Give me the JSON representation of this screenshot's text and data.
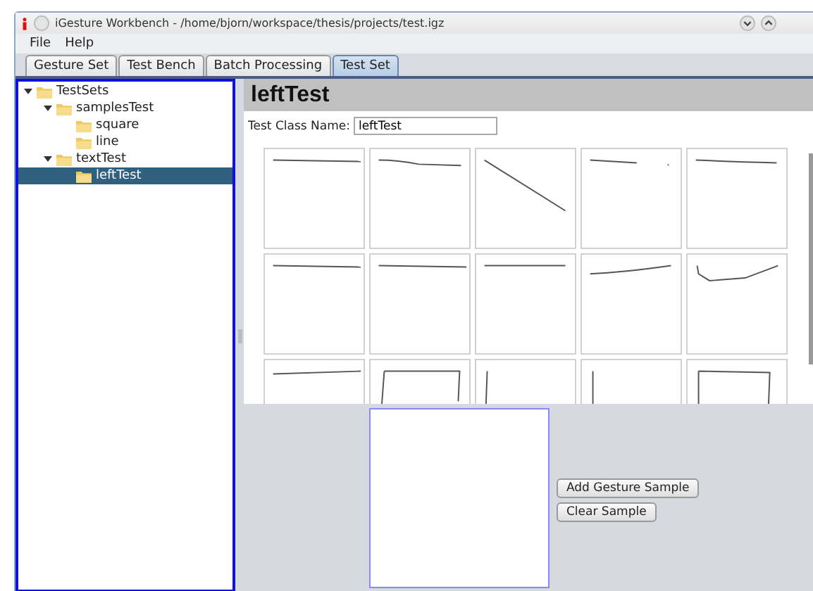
{
  "window": {
    "title": "iGesture Workbench - /home/bjorn/workspace/thesis/projects/test.igz"
  },
  "menu": [
    "File",
    "Help"
  ],
  "tabs": [
    {
      "label": "Gesture Set",
      "selected": false
    },
    {
      "label": "Test Bench",
      "selected": false
    },
    {
      "label": "Batch Processing",
      "selected": false
    },
    {
      "label": "Test Set",
      "selected": true
    }
  ],
  "tree": [
    {
      "label": "TestSets",
      "expanded": true,
      "selected": false,
      "children": [
        {
          "label": "samplesTest",
          "expanded": true,
          "selected": false,
          "children": [
            {
              "label": "square",
              "selected": false
            },
            {
              "label": "line",
              "selected": false
            }
          ]
        },
        {
          "label": "textTest",
          "expanded": true,
          "selected": false,
          "children": [
            {
              "label": "leftTest",
              "selected": true
            }
          ]
        }
      ]
    }
  ],
  "heading": "leftTest",
  "class_name": {
    "label": "Test Class Name:",
    "value": "leftTest"
  },
  "buttons": [
    "Add Gesture Sample",
    "Clear Sample"
  ]
}
